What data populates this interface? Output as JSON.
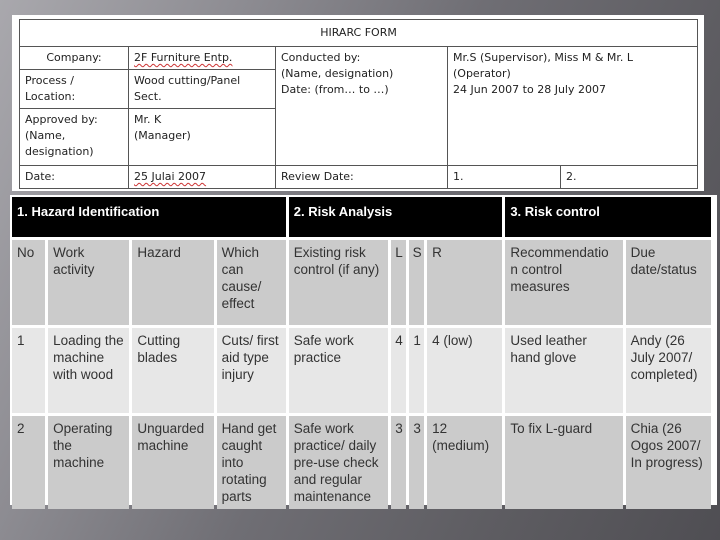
{
  "form": {
    "title": "HIRARC FORM",
    "company_label": "Company:",
    "company_value": "2F Furniture Entp.",
    "conducted_label": "Conducted by:",
    "conducted_sub1": "(Name, designation)",
    "conducted_sub2": "Date: (from… to …)",
    "conducted_value1": "Mr.S (Supervisor), Miss M & Mr. L",
    "conducted_value2": "(Operator)",
    "conducted_value3": "24 Jun 2007 to 28 July 2007",
    "process_label1": "Process /",
    "process_label2": "Location:",
    "process_value1": "Wood cutting/Panel",
    "process_value2": "Sect.",
    "approved_label1": "Approved by:",
    "approved_label2": "(Name,",
    "approved_label3": "designation)",
    "approved_value1": "Mr. K",
    "approved_value2": "(Manager)",
    "date_label": "Date:",
    "date_value": "25 Julai 2007",
    "review_label": "Review Date:",
    "review_1": "1.",
    "review_2": "2."
  },
  "hazard_table": {
    "sections": [
      "1. Hazard Identification",
      "2. Risk Analysis",
      "3. Risk control"
    ],
    "headers": {
      "no": "No",
      "work_activity": "Work activity",
      "hazard": "Hazard",
      "effect": "Which can cause/ effect",
      "existing_control": "Existing risk control (if any)",
      "l": "L",
      "s": "S",
      "r": "R",
      "recommendation": "Recommendatio n control measures",
      "due": "Due date/status"
    },
    "rows": [
      {
        "no": "1",
        "work_activity": "Loading the machine with wood",
        "hazard": "Cutting blades",
        "effect": "Cuts/ first aid type injury",
        "existing_control": "Safe work practice",
        "l": "4",
        "s": "1",
        "r": "4 (low)",
        "recommendation": "Used leather hand glove",
        "due": "Andy (26 July 2007/ completed)"
      },
      {
        "no": "2",
        "work_activity": "Operating the machine",
        "hazard": "Unguarded machine",
        "effect": "Hand get caught into rotating parts",
        "existing_control": "Safe work practice/ daily pre-use check and regular maintenance",
        "l": "3",
        "s": "3",
        "r": "12 (medium)",
        "recommendation": "To fix L-guard",
        "due": "Chia (26 Ogos 2007/ In progress)"
      }
    ]
  }
}
